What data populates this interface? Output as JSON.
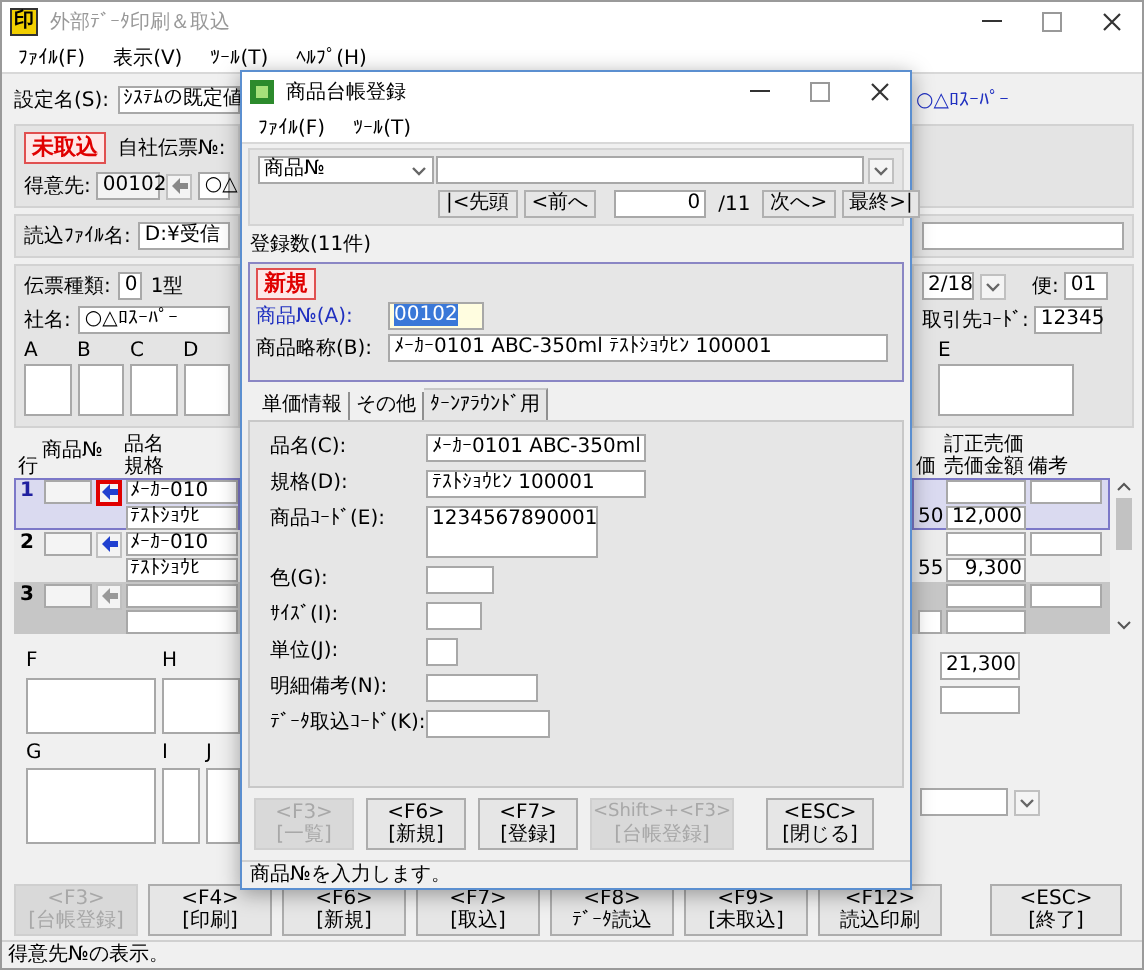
{
  "window": {
    "icon_text": "印",
    "title": "外部ﾃﾞｰﾀ印刷＆取込"
  },
  "menu": [
    "ﾌｧｲﾙ(F)",
    "表示(V)",
    "ﾂｰﾙ(T)",
    "ﾍﾙﾌﾟ(H)"
  ],
  "setting": {
    "label": "設定名(S):",
    "value": "ｼｽﾃﾑの既定値"
  },
  "customer_name_display": "○△ﾛｽｰﾊﾟｰ",
  "header": {
    "status_badge": "未取込",
    "own_slip_label": "自社伝票№:",
    "customer_label": "得意先:",
    "customer_code": "00102",
    "customer_name": "○△"
  },
  "file": {
    "label": "読込ﾌｧｲﾙ名:",
    "value": "D:¥受信"
  },
  "slip": {
    "type_label": "伝票種類:",
    "type_value": "0",
    "type_name": "1型",
    "company_label": "社名:",
    "company_value": "○△ﾛｽｰﾊﾟｰ",
    "boxes": [
      "A",
      "B",
      "C",
      "D"
    ],
    "date": "2/18",
    "flight_label": "便:",
    "flight_value": "01",
    "partner_label": "取引先ｺｰﾄﾞ:",
    "partner_value": "12345",
    "box_e": "E"
  },
  "lines": {
    "columns": [
      "行",
      "商品№",
      "品名",
      "規格",
      "価",
      "訂正売価",
      "売価金額",
      "備考"
    ],
    "rows": [
      {
        "no": "1",
        "kind": "item",
        "selected": true,
        "focused": true,
        "name": "ﾒｰｶｰ010",
        "spec": "ﾃｽﾄｼｮｳﾋ",
        "price_tail": "50",
        "amount": "12,000"
      },
      {
        "no": "2",
        "kind": "item",
        "selected": false,
        "focused": false,
        "name": "ﾒｰｶｰ010",
        "spec": "ﾃｽﾄｼｮｳﾋ",
        "price_tail": "55",
        "amount": "9,300"
      },
      {
        "no": "3",
        "kind": "new",
        "selected": false,
        "focused": false
      }
    ]
  },
  "footer": {
    "labels_top": [
      "F",
      "H"
    ],
    "labels_bottom": [
      "G",
      "I",
      "J"
    ],
    "total": "21,300"
  },
  "function_keys": [
    {
      "key": "<F3>",
      "label": "[台帳登録]",
      "disabled": true
    },
    {
      "key": "<F4>",
      "label": "[印刷]",
      "disabled": false
    },
    {
      "key": "<F6>",
      "label": "[新規]",
      "disabled": false
    },
    {
      "key": "<F7>",
      "label": "[取込]",
      "disabled": false
    },
    {
      "key": "<F8>",
      "label": "ﾃﾞｰﾀ読込",
      "disabled": false
    },
    {
      "key": "<F9>",
      "label": "[未取込]",
      "disabled": false
    },
    {
      "key": "<F12>",
      "label": "読込印刷",
      "disabled": false
    }
  ],
  "exit_button": {
    "key": "<ESC>",
    "label": "[終了]"
  },
  "status_bar": "得意先№の表示。",
  "dialog": {
    "title": "商品台帳登録",
    "menu": [
      "ﾌｧｲﾙ(F)",
      "ﾂｰﾙ(T)"
    ],
    "search_select": "商品№",
    "nav_prev": [
      "|<先頭",
      "<前へ"
    ],
    "record_value": "0",
    "record_total": "/11",
    "nav_next": [
      "次へ>",
      "最終>|"
    ],
    "count": "登録数(11件)",
    "mode_badge": "新規",
    "code_label": "商品№(A):",
    "code_value": "00102",
    "code_text_selected": true,
    "short_label": "商品略称(B):",
    "short_value": "ﾒｰｶｰ0101  ABC-350ml ﾃｽﾄｼｮｳﾋﾝ 100001",
    "tabs": [
      {
        "label": "単価情報",
        "selected": false
      },
      {
        "label": "その他",
        "selected": false
      },
      {
        "label": "ﾀｰﾝｱﾗｳﾝﾄﾞ用",
        "selected": true
      }
    ],
    "fields": [
      {
        "label": "品名(C):",
        "value": "ﾒｰｶｰ0101  ABC-350ml",
        "kind": "line"
      },
      {
        "label": "規格(D):",
        "value": "ﾃｽﾄｼｮｳﾋﾝ 100001",
        "kind": "line"
      },
      {
        "label": "商品ｺｰﾄﾞ(E):",
        "value": "1234567890001",
        "kind": "tall"
      },
      {
        "label": "色(G):",
        "kind": "line"
      },
      {
        "label": "ｻｲｽﾞ(I):",
        "kind": "line"
      },
      {
        "label": "単位(J):",
        "kind": "line"
      },
      {
        "label": "明細備考(N):",
        "kind": "line"
      },
      {
        "label": "ﾃﾞｰﾀ取込ｺｰﾄﾞ(K):",
        "kind": "line"
      }
    ],
    "buttons": [
      {
        "key": "<F3>",
        "label": "[一覧]",
        "disabled": true
      },
      {
        "key": "<F6>",
        "label": "[新規]",
        "disabled": false
      },
      {
        "key": "<F7>",
        "label": "[登録]",
        "disabled": false
      },
      {
        "key": "<Shift>+<F3>",
        "label": "[台帳登録]",
        "disabled": true
      }
    ],
    "close_button": {
      "key": "<ESC>",
      "label": "[閉じる]"
    },
    "status": "商品№を入力します。"
  }
}
